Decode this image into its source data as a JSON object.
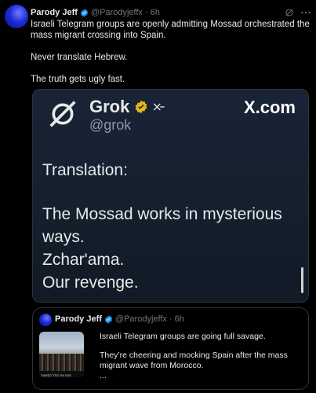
{
  "post": {
    "author_name": "Parody Jeff",
    "author_handle": "@Parodyjeffx",
    "time": "6h",
    "separator": "·",
    "more_icon": "more-horizontal-icon",
    "grok_icon": "grok-icon",
    "text_line1": "Israeli Telegram groups are openly admitting Mossad orchestrated the mass migrant crossing into Spain.",
    "text_line2": "Never translate Hebrew.",
    "text_line3": "The truth gets ugly fast."
  },
  "card": {
    "grok_name": "Grok",
    "grok_handle": "@grok",
    "brand": "X.com",
    "translation_label": "Translation:",
    "line1": "The Mossad works in mysterious ways.",
    "line2": "Zchar'ama.",
    "line3": "Our revenge."
  },
  "quote": {
    "author_name": "Parody Jeff",
    "author_handle": "@Parodyjeffx",
    "time": "6h",
    "separator": "·",
    "text1": "Israeli Telegram groups are going full savage.",
    "text2": "They’re cheering and mocking Spain after the mass migrant wave from Morocco.",
    "text3": "...",
    "thumb_caption": "פרצו את הגדר בסאוטה"
  },
  "colors": {
    "verified": "#1d9bf0",
    "gold_verified": "#e2b719",
    "handle_gray": "#71767b"
  }
}
